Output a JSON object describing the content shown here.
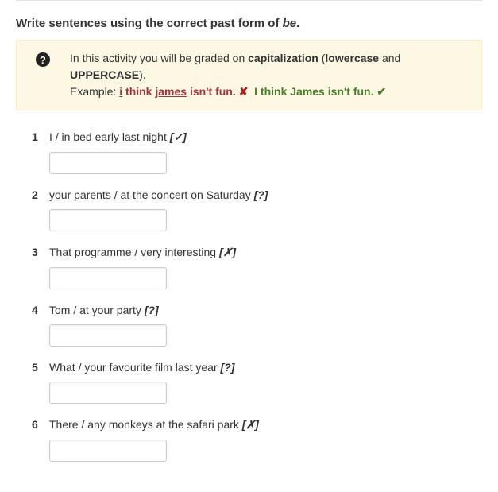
{
  "instruction": {
    "prefix": "Write sentences using the correct past form of ",
    "verb": "be",
    "suffix": "."
  },
  "info": {
    "text_part1": "In this activity you will be graded on ",
    "capitalization": "capitalization",
    "paren_open": " (",
    "lowercase": "lowercase",
    "and": " and ",
    "uppercase": "UPPERCASE",
    "paren_close": ").",
    "example_label": "Example: ",
    "wrong_seg1": "i",
    "wrong_seg2": " think ",
    "wrong_seg3": "james",
    "wrong_seg4": " isn't fun.",
    "x_mark": "✘",
    "correct": "I think James isn't fun.",
    "check_mark": "✔"
  },
  "questions": [
    {
      "num": "1",
      "prompt": "I / in bed early last night",
      "marker": "[✓]",
      "value": ""
    },
    {
      "num": "2",
      "prompt": "your parents / at the concert on Saturday",
      "marker": "[?]",
      "value": ""
    },
    {
      "num": "3",
      "prompt": "That programme / very interesting",
      "marker": "[✗]",
      "value": ""
    },
    {
      "num": "4",
      "prompt": "Tom / at your party",
      "marker": "[?]",
      "value": ""
    },
    {
      "num": "5",
      "prompt": "What / your favourite film last year",
      "marker": "[?]",
      "value": ""
    },
    {
      "num": "6",
      "prompt": "There / any monkeys at the safari park",
      "marker": "[✗]",
      "value": ""
    }
  ]
}
